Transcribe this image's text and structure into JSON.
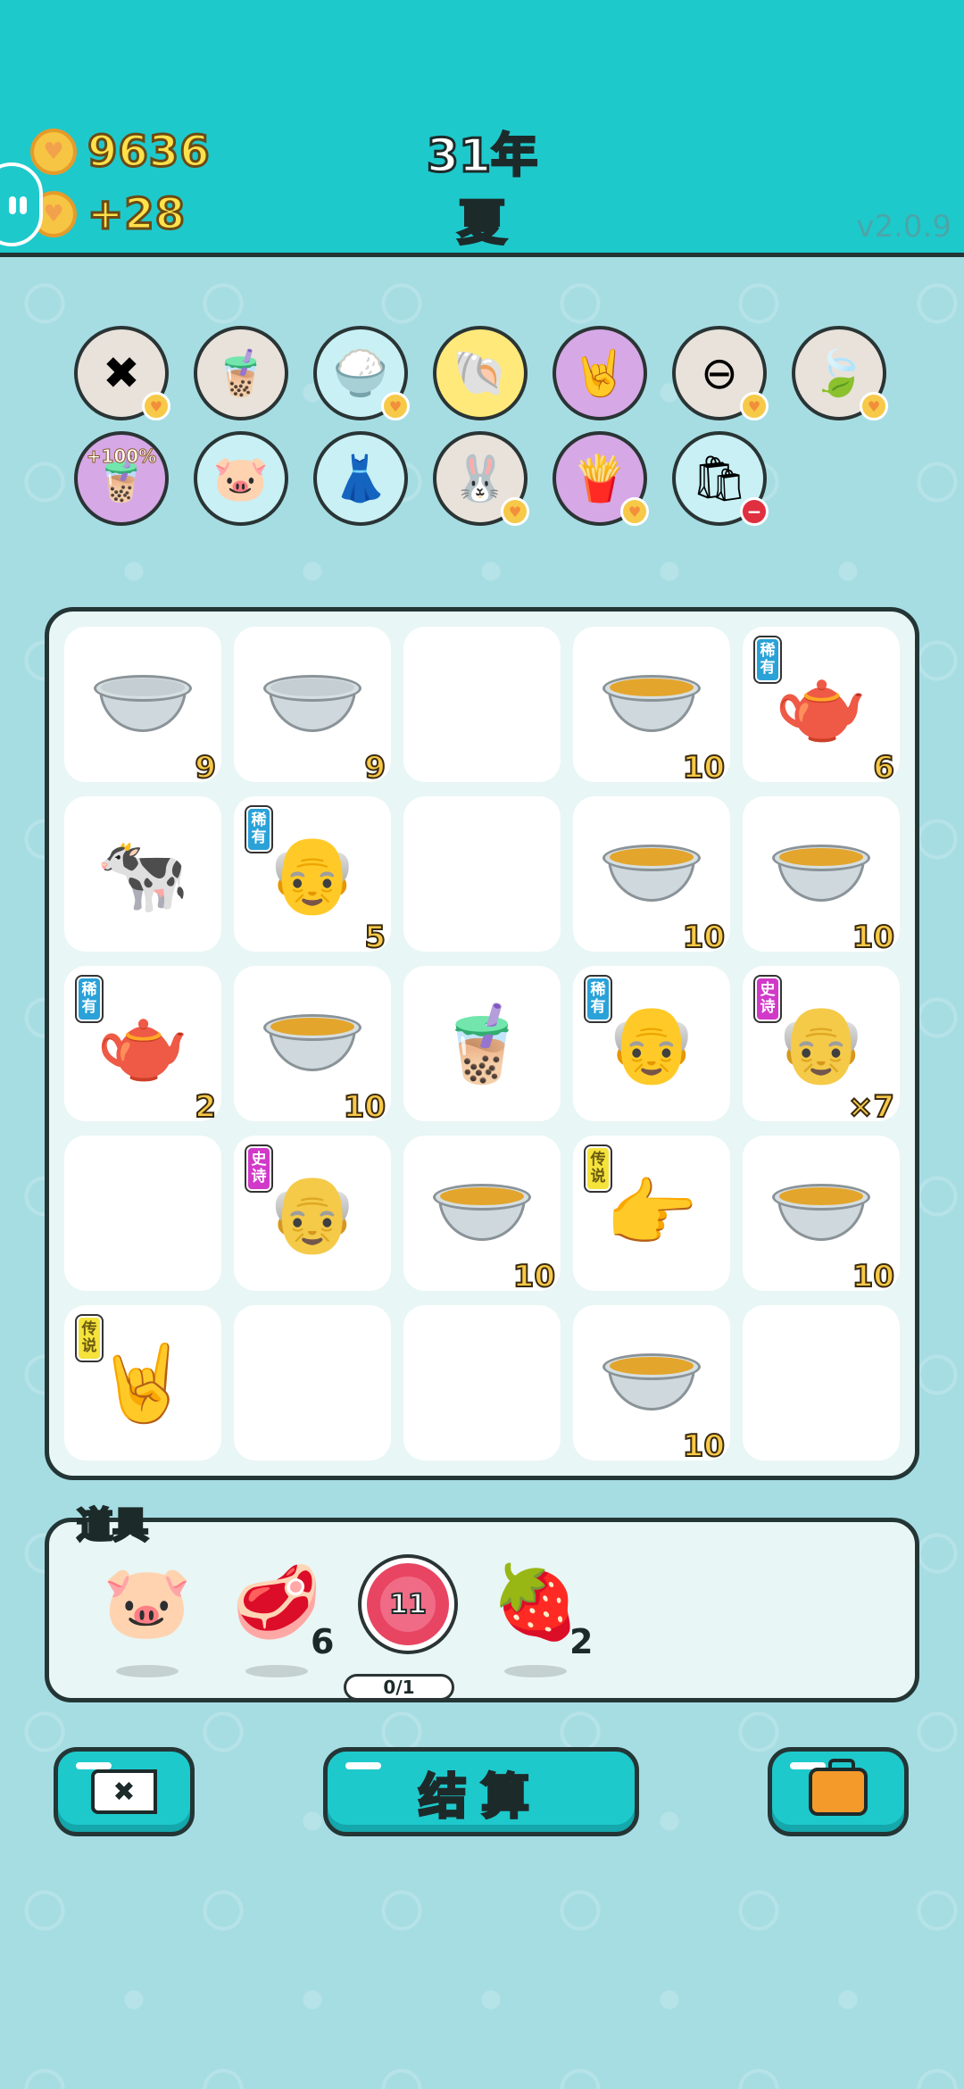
{
  "header": {
    "coins": "9636",
    "income": "+28",
    "year": "31年",
    "season": "夏",
    "version": "v2.0.9"
  },
  "buffs": [
    {
      "name": "tag-x-icon",
      "glyph": "✖",
      "bg": "#e8e2db",
      "badge": true
    },
    {
      "name": "bubble-tea-lid-icon",
      "glyph": "🧋",
      "bg": "#e8e2db"
    },
    {
      "name": "rice-bowl-icon",
      "glyph": "🍚",
      "bg": "#c8f0f5",
      "badge": true
    },
    {
      "name": "shell-icon",
      "glyph": "🐚",
      "bg": "#ffe97a"
    },
    {
      "name": "rock-hand-icon",
      "glyph": "🤘",
      "bg": "#d6a8e6"
    },
    {
      "name": "minus-circle-icon",
      "glyph": "⊖",
      "bg": "#e8e2db",
      "badge": true
    },
    {
      "name": "leaf-icon",
      "glyph": "🍃",
      "bg": "#e8e2db",
      "badge": true
    },
    {
      "name": "bubble-tea-boost-icon",
      "glyph": "🧋",
      "bg": "#d6a8e6",
      "pct": "+100%"
    },
    {
      "name": "piggy-bank-icon",
      "glyph": "🐷",
      "bg": "#c8f0f5"
    },
    {
      "name": "skirt-icon",
      "glyph": "👗",
      "bg": "#c8f0f5"
    },
    {
      "name": "rabbit-icon",
      "glyph": "🐰",
      "bg": "#e8e2db",
      "badge": true
    },
    {
      "name": "fries-icon",
      "glyph": "🍟",
      "bg": "#d6a8e6",
      "badge": true
    },
    {
      "name": "trash-bag-icon",
      "glyph": "🛍",
      "bg": "#c8f0f5",
      "badge_red": true
    }
  ],
  "board": [
    [
      {
        "kind": "bowl-empty",
        "count": "9"
      },
      {
        "kind": "bowl-empty",
        "count": "9"
      },
      {
        "kind": "none"
      },
      {
        "kind": "bowl",
        "count": "10"
      },
      {
        "kind": "teapot",
        "count": "6",
        "tag": "稀有",
        "tag_type": "rare"
      }
    ],
    [
      {
        "kind": "cow"
      },
      {
        "kind": "old-man",
        "count": "5",
        "tag": "稀有",
        "tag_type": "rare"
      },
      {
        "kind": "none"
      },
      {
        "kind": "bowl",
        "count": "10"
      },
      {
        "kind": "bowl",
        "count": "10"
      }
    ],
    [
      {
        "kind": "teapot",
        "count": "2",
        "tag": "稀有",
        "tag_type": "rare"
      },
      {
        "kind": "bowl",
        "count": "10"
      },
      {
        "kind": "bubble-tea"
      },
      {
        "kind": "old-man",
        "tag": "稀有",
        "tag_type": "rare"
      },
      {
        "kind": "old-man-glasses",
        "count": "×7",
        "tag": "史诗",
        "tag_type": "epic"
      }
    ],
    [
      {
        "kind": "none"
      },
      {
        "kind": "old-man-glasses",
        "tag": "史诗",
        "tag_type": "epic"
      },
      {
        "kind": "bowl",
        "count": "10"
      },
      {
        "kind": "point-hand",
        "tag": "传说",
        "tag_type": "legend"
      },
      {
        "kind": "bowl",
        "count": "10"
      }
    ],
    [
      {
        "kind": "rock-hand",
        "tag": "传说",
        "tag_type": "legend"
      },
      {
        "kind": "none"
      },
      {
        "kind": "none"
      },
      {
        "kind": "bowl",
        "count": "10"
      },
      {
        "kind": "none"
      }
    ]
  ],
  "props": {
    "title": "道具",
    "items": [
      {
        "name": "piggy-bank-prop",
        "glyph": "🐷",
        "count": ""
      },
      {
        "name": "liver-prop",
        "glyph": "🥩",
        "count": "6"
      },
      {
        "name": "target-prop",
        "target_value": "11",
        "progress": "0/1"
      },
      {
        "name": "lychee-prop",
        "glyph": "🍓",
        "count": "2"
      }
    ]
  },
  "buttons": {
    "delete_label": "✖",
    "settle_label": "结算"
  }
}
